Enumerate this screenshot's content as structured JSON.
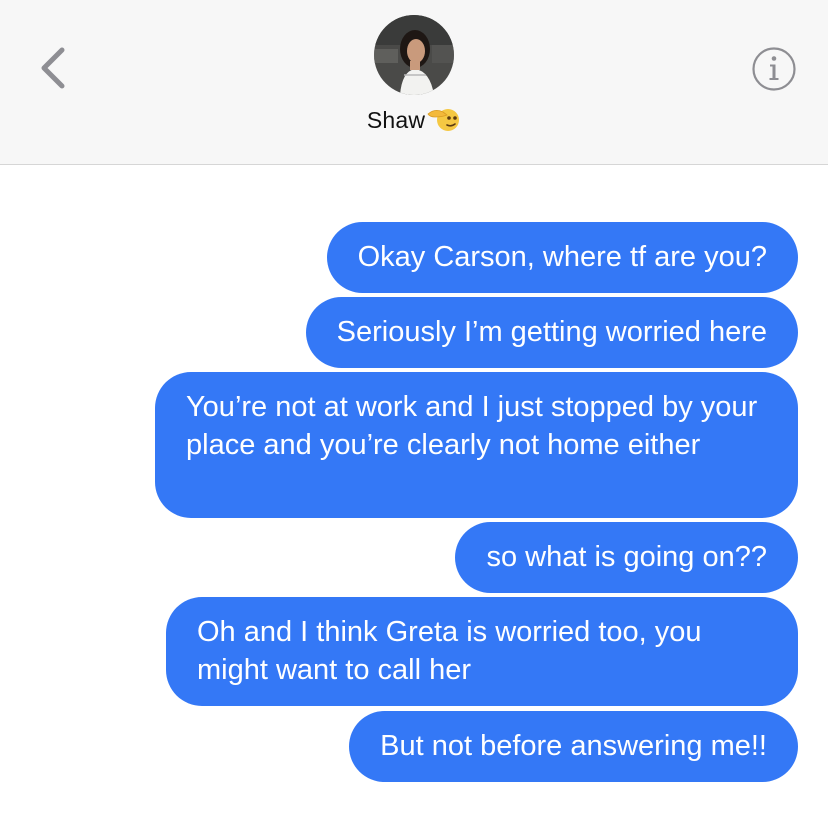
{
  "header": {
    "contact_name": "Shaw",
    "icons": {
      "back": "chevron-left-icon",
      "info": "info-circle-icon",
      "emoji": "saluting-face-emoji"
    }
  },
  "messages": [
    {
      "text": "Okay Carson, where tf are you?"
    },
    {
      "text": "Seriously I’m getting worried here"
    },
    {
      "text": "You’re not at work and I just stopped by your place and you’re clearly not home either"
    },
    {
      "text": "so what is going on??"
    },
    {
      "text": "Oh and I think Greta is worried too, you might want to call her"
    },
    {
      "text": "But not before answering me!!"
    }
  ],
  "colors": {
    "bubble": "#3478f6",
    "header_bg": "#f7f7f7",
    "icon_gray": "#8e8e93"
  }
}
